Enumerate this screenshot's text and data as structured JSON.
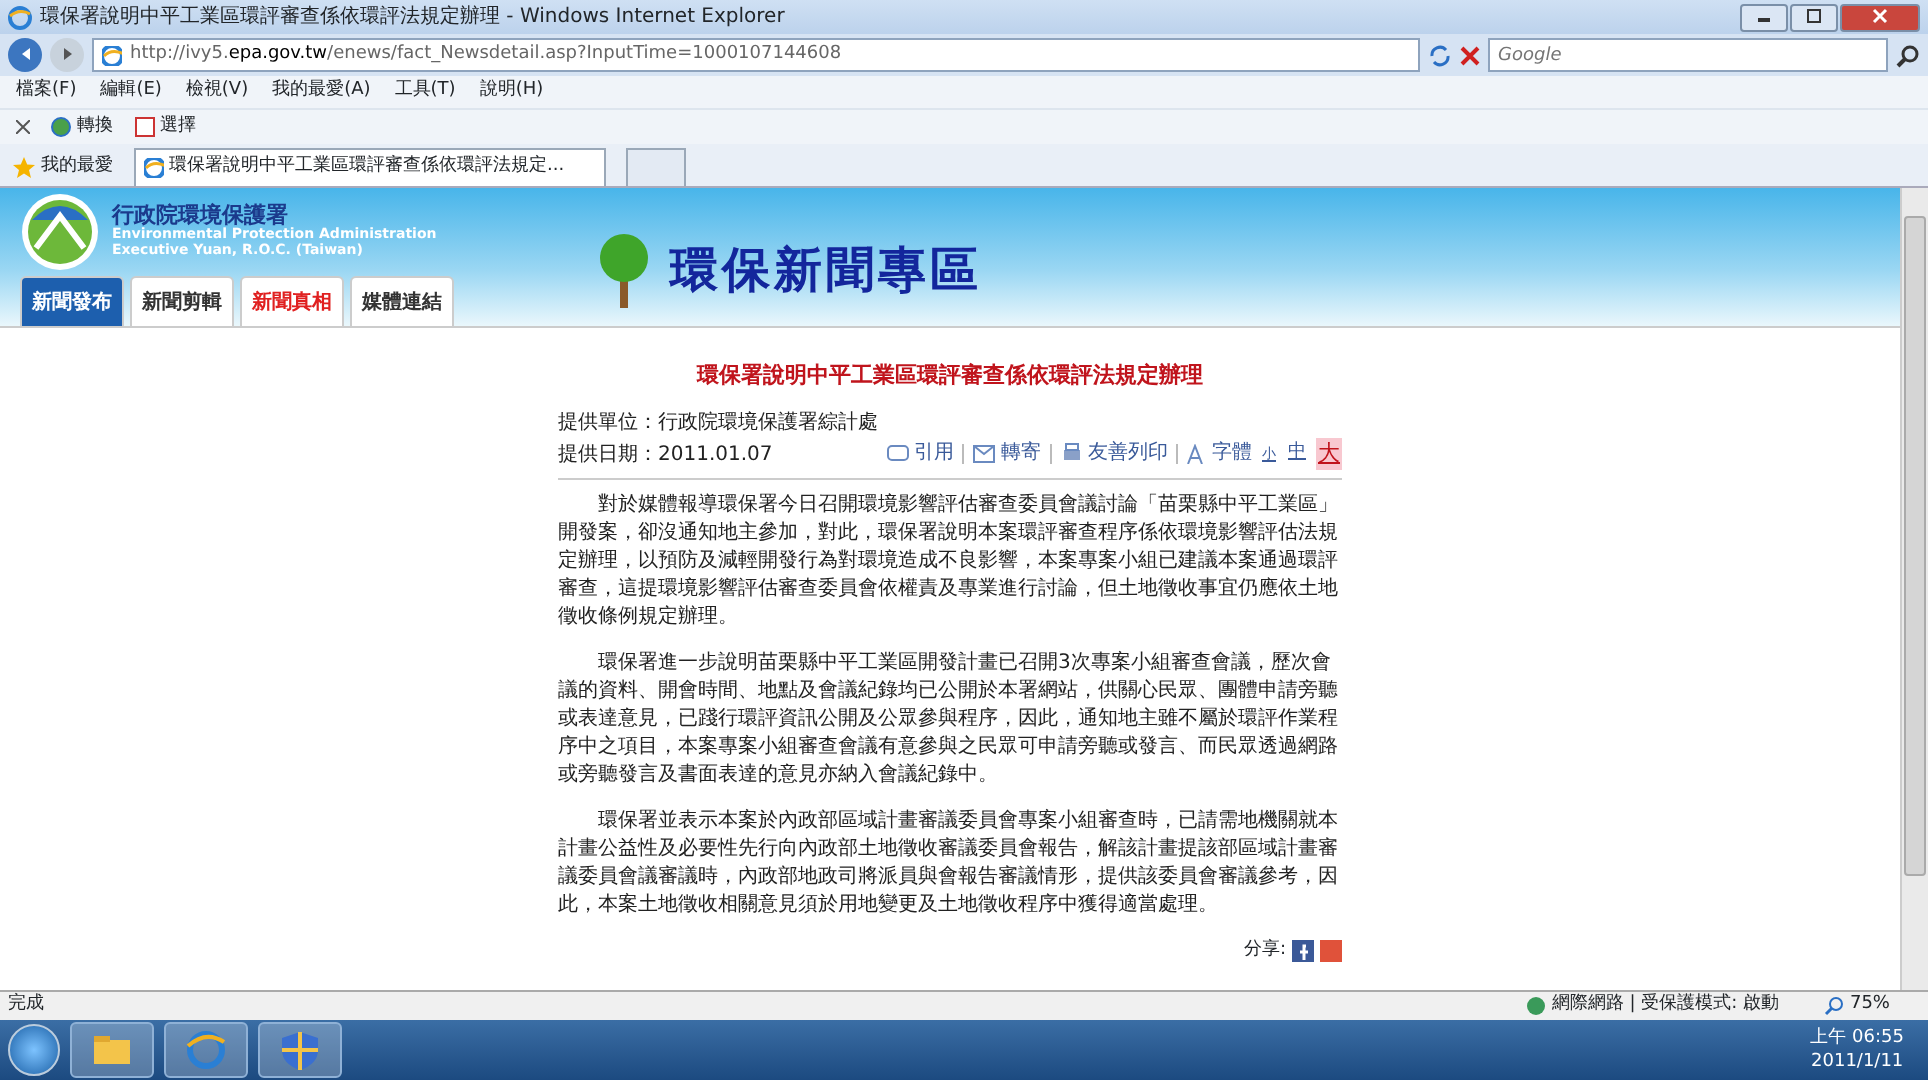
{
  "window": {
    "title": "環保署說明中平工業區環評審查係依環評法規定辦理 - Windows Internet Explorer"
  },
  "address_bar": {
    "url_prefix": "http://ivy5.",
    "url_domain": "epa.gov.tw",
    "url_rest": "/enews/fact_Newsdetail.asp?InputTime=1000107144608"
  },
  "search": {
    "placeholder": "Google"
  },
  "menu": [
    "檔案(F)",
    "編輯(E)",
    "檢視(V)",
    "我的最愛(A)",
    "工具(T)",
    "說明(H)"
  ],
  "toolbar": [
    {
      "label": "轉換"
    },
    {
      "label": "選擇"
    }
  ],
  "favorites": {
    "label": "我的最愛"
  },
  "browser_tabs": [
    {
      "label": "環保署說明中平工業區環評審查係依環評法規定...",
      "selected": true
    }
  ],
  "site": {
    "agency": "行政院環境保護署",
    "agency_en_1": "Environmental Protection Administration",
    "agency_en_2": "Executive Yuan, R.O.C. (Taiwan)",
    "banner_title": "環保新聞專區",
    "nav": [
      {
        "label": "新聞發布",
        "selected": true
      },
      {
        "label": "新聞剪輯",
        "selected": false,
        "color": "#333333"
      },
      {
        "label": "新聞真相",
        "selected": false,
        "color": "#e02020"
      },
      {
        "label": "媒體連結",
        "selected": false,
        "color": "#333333"
      }
    ]
  },
  "article": {
    "title": "環保署說明中平工業區環評審查係依環評法規定辦理",
    "unit": "提供單位：行政院環境保護署綜計處",
    "date": "提供日期：2011.01.07",
    "tools": [
      "引用",
      "轉寄",
      "友善列印"
    ],
    "font_label": "字體",
    "font_sizes": [
      {
        "label": "小",
        "selected": false
      },
      {
        "label": "中",
        "selected": false
      },
      {
        "label": "大",
        "selected": true
      }
    ],
    "paragraphs": [
      "對於媒體報導環保署今日召開環境影響評估審查委員會議討論「苗栗縣中平工業區」開發案，卻沒通知地主參加，對此，環保署說明本案環評審查程序係依環境影響評估法規定辦理，以預防及減輕開發行為對環境造成不良影響，本案專案小組已建議本案通過環評審查，這提環境影響評估審查委員會依權責及專業進行討論，但土地徵收事宜仍應依土地徵收條例規定辦理。",
      "環保署進一步說明苗栗縣中平工業區開發計畫已召開3次專案小組審查會議，歷次會議的資料、開會時間、地點及會議紀錄均已公開於本署網站，供關心民眾、團體申請旁聽或表達意見，已踐行環評資訊公開及公眾參與程序，因此，通知地主雖不屬於環評作業程序中之項目，本案專案小組審查會議有意參與之民眾可申請旁聽或發言、而民眾透過網路或旁聽發言及書面表達的意見亦納入會議紀錄中。",
      "環保署並表示本案於內政部區域計畫審議委員會專案小組審查時，已請需地機關就本計畫公益性及必要性先行向內政部土地徵收審議委員會報告，解該計畫提該部區域計畫審議委員會議審議時，內政部地政司將派員與會報告審議情形，提供該委員會審議參考，因此，本案土地徵收相關意見須於用地變更及土地徵收程序中獲得適當處理。"
    ],
    "share_label": "分享:"
  },
  "status_bar": {
    "text": "完成",
    "zone": "網際網路 | 受保護模式: 啟動",
    "zoom": "75%"
  },
  "taskbar": {
    "time": "上午 06:55",
    "date": "2011/1/11"
  }
}
